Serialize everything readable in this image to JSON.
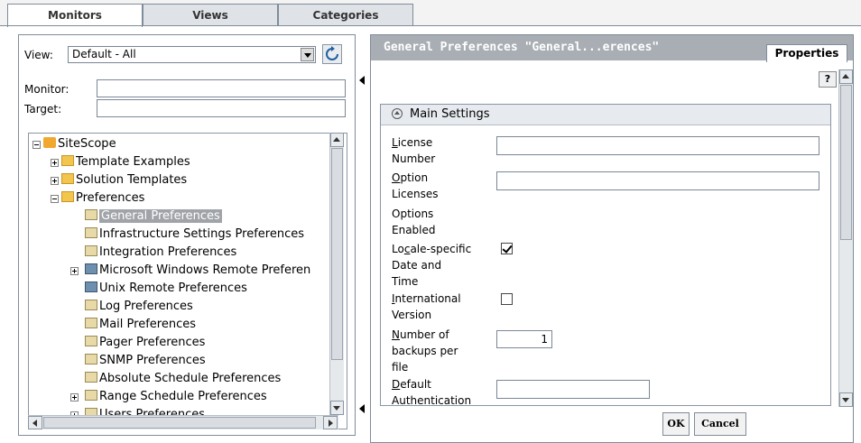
{
  "tabs": [
    {
      "label": "Monitors",
      "active": true
    },
    {
      "label": "Views",
      "active": false
    },
    {
      "label": "Categories",
      "active": false
    }
  ],
  "left": {
    "view_label": "View:",
    "view_value": "Default - All",
    "monitor_label": "Monitor:",
    "monitor_value": "",
    "target_label": "Target:",
    "target_value": "",
    "tree": [
      {
        "label": "SiteScope",
        "icon": "sitescope-icon",
        "expander": "minus"
      },
      {
        "label": "Template Examples",
        "icon": "folder-icon",
        "expander": "plus"
      },
      {
        "label": "Solution Templates",
        "icon": "folder-icon",
        "expander": "plus"
      },
      {
        "label": "Preferences",
        "icon": "folder-icon",
        "expander": "minus"
      },
      {
        "label": "General Preferences",
        "icon": "preferences-icon",
        "expander": "",
        "selected": true
      },
      {
        "label": "Infrastructure Settings Preferences",
        "icon": "preferences-icon",
        "expander": ""
      },
      {
        "label": "Integration Preferences",
        "icon": "preferences-icon",
        "expander": ""
      },
      {
        "label": "Microsoft Windows Remote Preferen",
        "icon": "monitor-icon",
        "expander": "plus"
      },
      {
        "label": "Unix Remote Preferences",
        "icon": "monitor-icon",
        "expander": ""
      },
      {
        "label": "Log Preferences",
        "icon": "preferences-icon",
        "expander": ""
      },
      {
        "label": "Mail Preferences",
        "icon": "preferences-icon",
        "expander": ""
      },
      {
        "label": "Pager Preferences",
        "icon": "preferences-icon",
        "expander": ""
      },
      {
        "label": "SNMP Preferences",
        "icon": "preferences-icon",
        "expander": ""
      },
      {
        "label": "Absolute Schedule Preferences",
        "icon": "preferences-icon",
        "expander": ""
      },
      {
        "label": "Range Schedule Preferences",
        "icon": "preferences-icon",
        "expander": "plus"
      },
      {
        "label": "Users Preferences",
        "icon": "preferences-icon",
        "expander": "plus"
      }
    ]
  },
  "right": {
    "title": "General Preferences \"General...erences\"",
    "properties_tab": "Properties",
    "help_label": "?",
    "section_title": "Main Settings",
    "fields": {
      "license_label_1": "License",
      "license_label_2": "Number",
      "license_value": "",
      "option_label_1": "Option",
      "option_label_2": "Licenses",
      "option_value": "",
      "enabled_label_1": "Options",
      "enabled_label_2": "Enabled",
      "locale_label_1": "Locale-specific",
      "locale_label_2": "Date and",
      "locale_label_3": "Time",
      "locale_checked": true,
      "intl_label_1": "International",
      "intl_label_2": "Version",
      "intl_checked": false,
      "backups_label_1": "Number of",
      "backups_label_2": "backups per",
      "backups_label_3": "file",
      "backups_value": "1",
      "auth_label_1": "Default",
      "auth_label_2": "Authentication",
      "auth_value": ""
    },
    "ok_label": "OK",
    "cancel_label": "Cancel"
  },
  "colors": {
    "header_bg": "#a8aeb4",
    "selection_bg": "#a0a4a8",
    "border": "#7f8c99"
  }
}
